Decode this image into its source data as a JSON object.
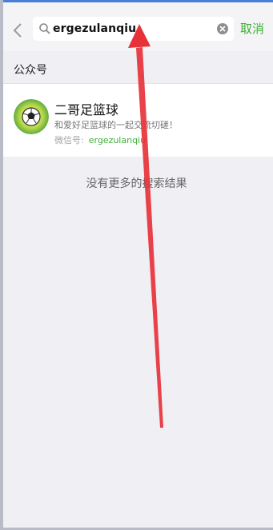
{
  "search": {
    "query": "ergezulanqiu",
    "cancel_label": "取消"
  },
  "section": {
    "title": "公众号"
  },
  "result": {
    "name": "二哥足篮球",
    "description": "和爱好足篮球的一起交流切磋！",
    "id_label": "微信号:",
    "id_value": "ergezulanqiu"
  },
  "status": {
    "no_more": "没有更多的搜索结果"
  },
  "colors": {
    "accent": "#3cb035",
    "annotation_arrow": "#e8323a"
  }
}
